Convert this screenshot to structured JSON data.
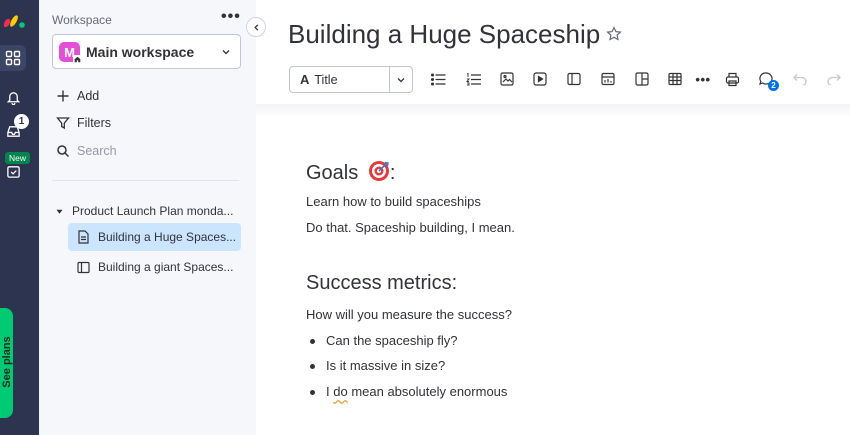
{
  "rail": {
    "inbox_badge": "1",
    "new_badge": "New",
    "plans_label": "See plans"
  },
  "sidebar": {
    "workspace_label": "Workspace",
    "more_label": "•••",
    "workspace_initial": "M",
    "workspace_name": "Main workspace",
    "actions": {
      "add": "Add",
      "filters": "Filters",
      "search_placeholder": "Search"
    },
    "tree": {
      "folder": "Product Launch Plan monda...",
      "items": [
        {
          "label": "Building a Huge Spaces...",
          "icon": "doc-icon",
          "active": true
        },
        {
          "label": "Building a giant Spaces...",
          "icon": "board-icon",
          "active": false
        }
      ]
    }
  },
  "main": {
    "title": "Building a Huge Spaceship",
    "toolbar": {
      "style_letter": "A",
      "style_value": "Title",
      "more_label": "•••",
      "comments_count": "2"
    },
    "doc": {
      "goals_heading": "Goals",
      "goals_suffix": ":",
      "goals_lines": [
        "Learn how to build spaceships",
        "Do that. Spaceship building, I mean."
      ],
      "metrics_heading": "Success metrics:",
      "metrics_intro": "How will you measure the success?",
      "metrics_items": [
        "Can the spaceship fly?",
        "Is it massive in size?"
      ],
      "last_item_prefix": "I ",
      "last_item_squiggle": "do",
      "last_item_rest": " mean absolutely enormous"
    }
  },
  "colors": {
    "rail": "#2c3450",
    "sidebar": "#f6f7fb",
    "active_item": "#cce5ff",
    "accent": "#0073ea",
    "plans_green": "#00ca72"
  }
}
